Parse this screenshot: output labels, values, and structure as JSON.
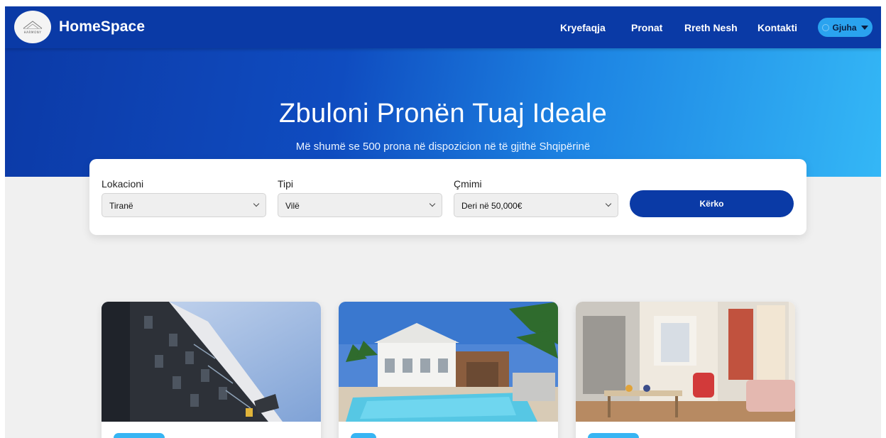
{
  "navbar": {
    "logo_text": "HARMONY",
    "brand": "HomeSpace",
    "links": [
      "Kryefaqja",
      "Pronat",
      "Rreth Nesh",
      "Kontakti"
    ],
    "language_label": "Gjuha"
  },
  "hero": {
    "title": "Zbuloni Pronën Tuaj Ideale",
    "subtitle": "Më shumë se 500 prona në dispozicion në të gjithë Shqipërinë"
  },
  "search": {
    "location_label": "Lokacioni",
    "location_value": "Tiranë",
    "type_label": "Tipi",
    "type_value": "Vilë",
    "price_label": "Çmimi",
    "price_value": "Deri në 50,000€",
    "button_label": "Kërko"
  },
  "cards": [
    {
      "image": "apartment-building-photo",
      "badge": ""
    },
    {
      "image": "villa-pool-photo",
      "badge": ""
    },
    {
      "image": "living-room-interior-photo",
      "badge": ""
    }
  ],
  "colors": {
    "primary": "#0a3aa6",
    "accent": "#37b5f3",
    "background": "#f0f0f0"
  }
}
